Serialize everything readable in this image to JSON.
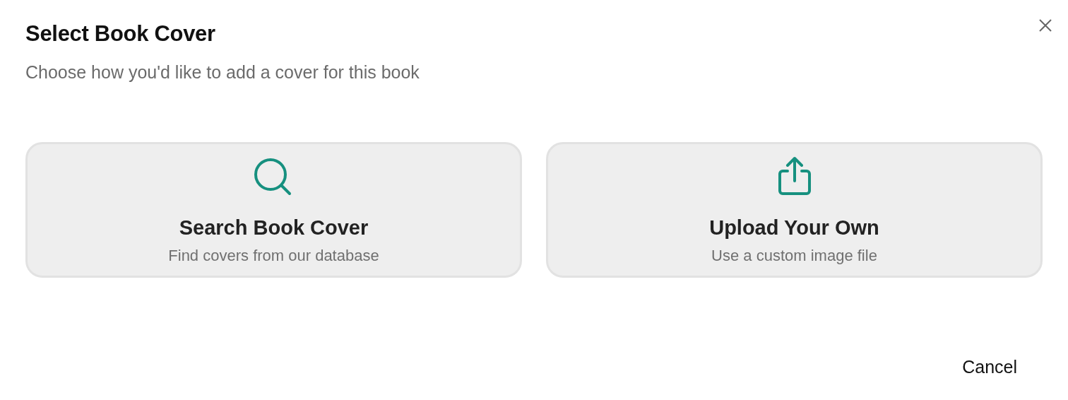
{
  "dialog": {
    "title": "Select Book Cover",
    "subtitle": "Choose how you'd like to add a cover for this book"
  },
  "options": [
    {
      "kind": "search",
      "title": "Search Book Cover",
      "description": "Find covers from our database"
    },
    {
      "kind": "upload",
      "title": "Upload Your Own",
      "description": "Use a custom image file"
    }
  ],
  "buttons": [
    "Cancel"
  ]
}
